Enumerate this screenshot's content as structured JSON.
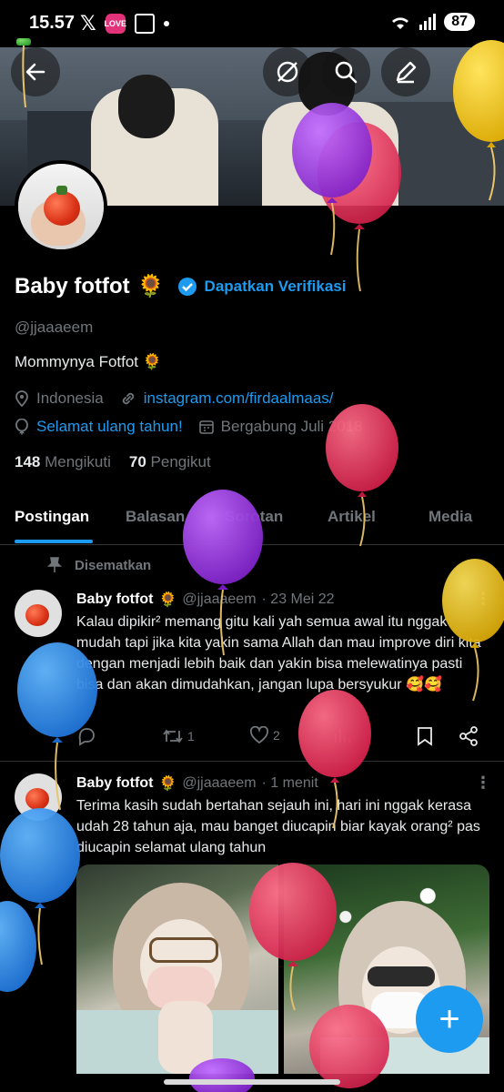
{
  "status_bar": {
    "time": "15.57",
    "x_glyph": "𝕏",
    "app_badge": "LOVE",
    "battery": "87"
  },
  "profile": {
    "name": "Baby fotfot",
    "name_emoji": "🌻",
    "verify_cta": "Dapatkan Verifikasi",
    "handle": "@jjaaaeem",
    "bio": "Mommynya Fotfot 🌻",
    "location": "Indonesia",
    "website": "instagram.com/firdaalmaas/",
    "birthday_link": "Selamat ulang tahun!",
    "joined": "Bergabung Juli 2018",
    "following_count": "148",
    "following_label": "Mengikuti",
    "followers_count": "70",
    "followers_label": "Pengikut"
  },
  "tabs": [
    {
      "label": "Postingan"
    },
    {
      "label": "Balasan"
    },
    {
      "label": "Sorotan"
    },
    {
      "label": "Artikel"
    },
    {
      "label": "Media"
    }
  ],
  "posts": [
    {
      "pinned_label": "Disematkan",
      "name": "Baby fotfot",
      "emoji": "🌻",
      "handle": "@jjaaaeem",
      "time": "· 23 Mei 22",
      "text": "Kalau dipikir² memang gitu kali yah semua awal itu nggak mudah tapi jika kita yakin sama Allah dan mau improve diri kita dengan menjadi lebih baik dan yakin bisa melewatinya pasti bisa dan akan dimudahkan, jangan lupa bersyukur 🥰🥰",
      "retweets": "1",
      "likes": "2"
    },
    {
      "name": "Baby fotfot",
      "emoji": "🌻",
      "handle": "@jjaaaeem",
      "time": "· 1 menit",
      "text": "Terima kasih sudah bertahan sejauh ini, hari ini nggak kerasa udah 28 tahun aja, mau banget diucapin biar kayak orang² pas diucapin selamat ulang tahun"
    }
  ],
  "fab_label": "+",
  "icons": {
    "back": "arrow-left-icon",
    "grok": "grok-icon",
    "search": "search-icon",
    "edit": "edit-icon",
    "location": "location-icon",
    "link": "link-icon",
    "balloon": "balloon-icon",
    "calendar": "calendar-icon",
    "pin": "pin-icon",
    "reply": "reply-icon",
    "retweet": "retweet-icon",
    "like": "heart-icon",
    "views": "views-icon",
    "bookmark": "bookmark-icon",
    "share": "share-icon"
  },
  "colors": {
    "accent": "#1d9bf0",
    "background": "#000000",
    "muted": "#71767b"
  }
}
